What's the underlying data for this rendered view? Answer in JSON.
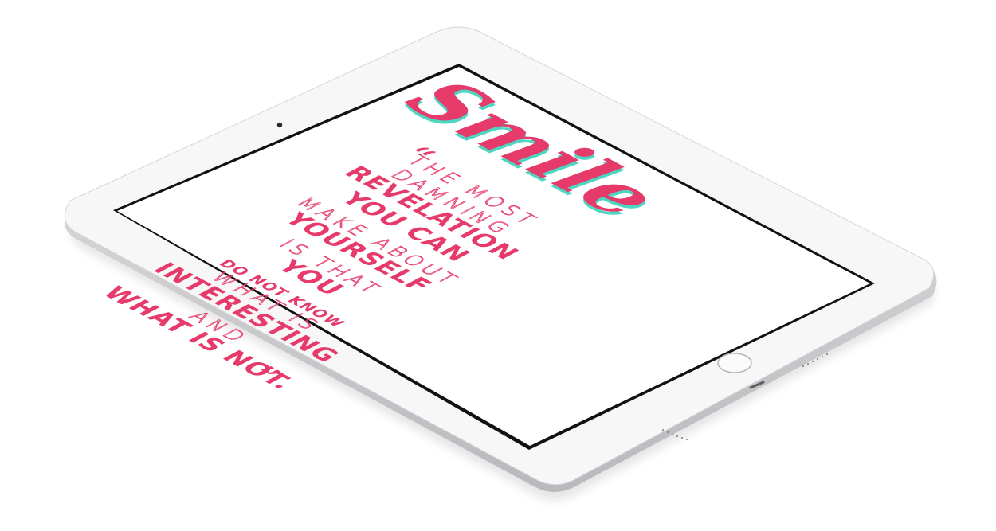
{
  "device": {
    "name": "iPad",
    "body_color": "#f7f7f8",
    "bezel_edge_color": "#c9c9cc",
    "screen_border_color": "#111111"
  },
  "screen": {
    "background": "#ffffff",
    "title": "Smile",
    "title_colors": {
      "main": "#e63a6b",
      "shadow": "#2fd1b8"
    },
    "quote": {
      "open_mark": "“",
      "close_mark": "”",
      "accent_color": "#e63a6b",
      "lines": [
        {
          "text": "THE MOST",
          "style": "thin"
        },
        {
          "text": "DAMNING",
          "style": "thin"
        },
        {
          "text": "REVELATION",
          "style": "bold"
        },
        {
          "text": "YOU CAN",
          "style": "bold"
        },
        {
          "text": "MAKE ABOUT",
          "style": "thin"
        },
        {
          "text": "YOURSELF",
          "style": "bold"
        },
        {
          "text": "IS THAT",
          "style": "thin"
        },
        {
          "text": "YOU",
          "style": "bold"
        },
        {
          "text": "DO NOT KNOW",
          "style": "bold-small"
        },
        {
          "text": "WHAT IS",
          "style": "thin"
        },
        {
          "text": "INTERESTING",
          "style": "bold"
        },
        {
          "text": "AND",
          "style": "thin"
        },
        {
          "text": "WHAT IS NOT.",
          "style": "bold"
        }
      ]
    }
  },
  "icons": [
    "camera-icon",
    "home-button-icon",
    "speaker-grille-icon",
    "lightning-port-icon"
  ]
}
